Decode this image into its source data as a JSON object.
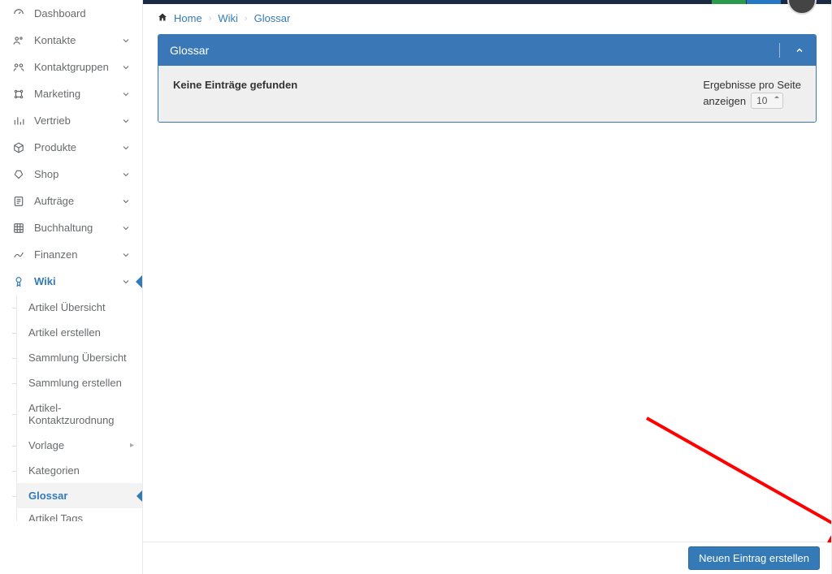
{
  "breadcrumb": {
    "home": "Home",
    "wiki": "Wiki",
    "glossar": "Glossar"
  },
  "sidebar": {
    "items": [
      {
        "label": "Dashboard"
      },
      {
        "label": "Kontakte"
      },
      {
        "label": "Kontaktgruppen"
      },
      {
        "label": "Marketing"
      },
      {
        "label": "Vertrieb"
      },
      {
        "label": "Produkte"
      },
      {
        "label": "Shop"
      },
      {
        "label": "Aufträge"
      },
      {
        "label": "Buchhaltung"
      },
      {
        "label": "Finanzen"
      },
      {
        "label": "Wiki"
      }
    ]
  },
  "wiki_subnav": {
    "items": [
      {
        "label": "Artikel Übersicht"
      },
      {
        "label": "Artikel erstellen"
      },
      {
        "label": "Sammlung Übersicht"
      },
      {
        "label": "Sammlung erstellen"
      },
      {
        "label": "Artikel-Kontaktzurodnung"
      },
      {
        "label": "Vorlage"
      },
      {
        "label": "Kategorien"
      },
      {
        "label": "Glossar"
      },
      {
        "label": "Artikel Tags"
      }
    ]
  },
  "panel": {
    "title": "Glossar",
    "empty_text": "Keine Einträge gefunden",
    "per_page_line1": "Ergebnisse pro Seite",
    "per_page_line2": "anzeigen",
    "page_size_value": "10"
  },
  "footer": {
    "cta_label": "Neuen Eintrag erstellen"
  }
}
